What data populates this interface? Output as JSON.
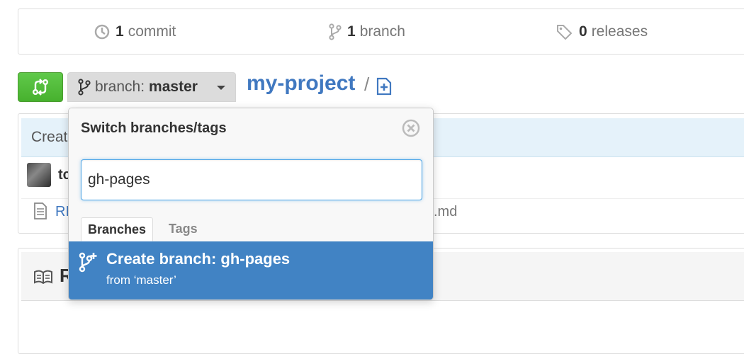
{
  "stats": {
    "commits_count": "1",
    "commits_label": "commit",
    "branches_count": "1",
    "branches_label": "branch",
    "releases_count": "0",
    "releases_label": "releases"
  },
  "toolbar": {
    "branch_prefix": "branch:",
    "branch_name": "master",
    "repo_name": "my-project",
    "separator": "/"
  },
  "background": {
    "commit_message_fragment": "Creat",
    "author_fragment": "tc",
    "file_fragment": "RI",
    "file_ext_fragment": ".md",
    "readme_fragment": "R"
  },
  "dropdown": {
    "title": "Switch branches/tags",
    "filter_value": "gh-pages",
    "tabs": [
      {
        "label": "Branches",
        "active": true
      },
      {
        "label": "Tags",
        "active": false
      }
    ],
    "create": {
      "title": "Create branch: gh-pages",
      "subtitle": "from ‘master’"
    }
  },
  "colors": {
    "accent": "#4183c4",
    "link": "#4078c0",
    "compare_green": "#55bd3c"
  },
  "icons": [
    "commit-icon",
    "branch-icon",
    "tag-icon",
    "compare-icon",
    "new-file-icon",
    "close-icon",
    "file-icon",
    "book-icon",
    "create-branch-icon"
  ]
}
